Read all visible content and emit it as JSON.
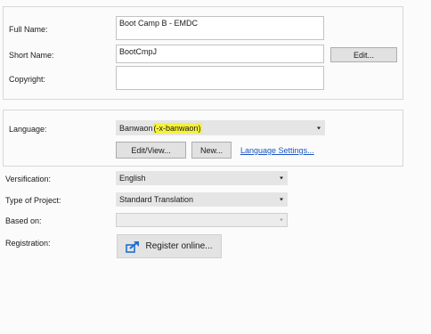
{
  "project": {
    "full_name_label": "Full Name:",
    "full_name_value": "Boot Camp B - EMDC",
    "short_name_label": "Short Name:",
    "short_name_value": "BootCmpJ",
    "edit_button": "Edit...",
    "copyright_label": "Copyright:",
    "copyright_value": ""
  },
  "language": {
    "label": "Language:",
    "selected_name": "Banwaon ",
    "selected_code": "(-x-banwaon)",
    "edit_view_button": "Edit/View...",
    "new_button": "New...",
    "settings_link": "Language Settings..."
  },
  "options": {
    "versification_label": "Versification:",
    "versification_value": "English",
    "project_type_label": "Type of Project:",
    "project_type_value": "Standard Translation",
    "based_on_label": "Based on:",
    "based_on_value": "",
    "registration_label": "Registration:",
    "register_button": "Register online..."
  },
  "colors": {
    "highlight": "#f6f23a",
    "link": "#1a56c4",
    "register_icon": "#1f6fd1"
  },
  "icons": {
    "register": "register-arrow-icon"
  }
}
